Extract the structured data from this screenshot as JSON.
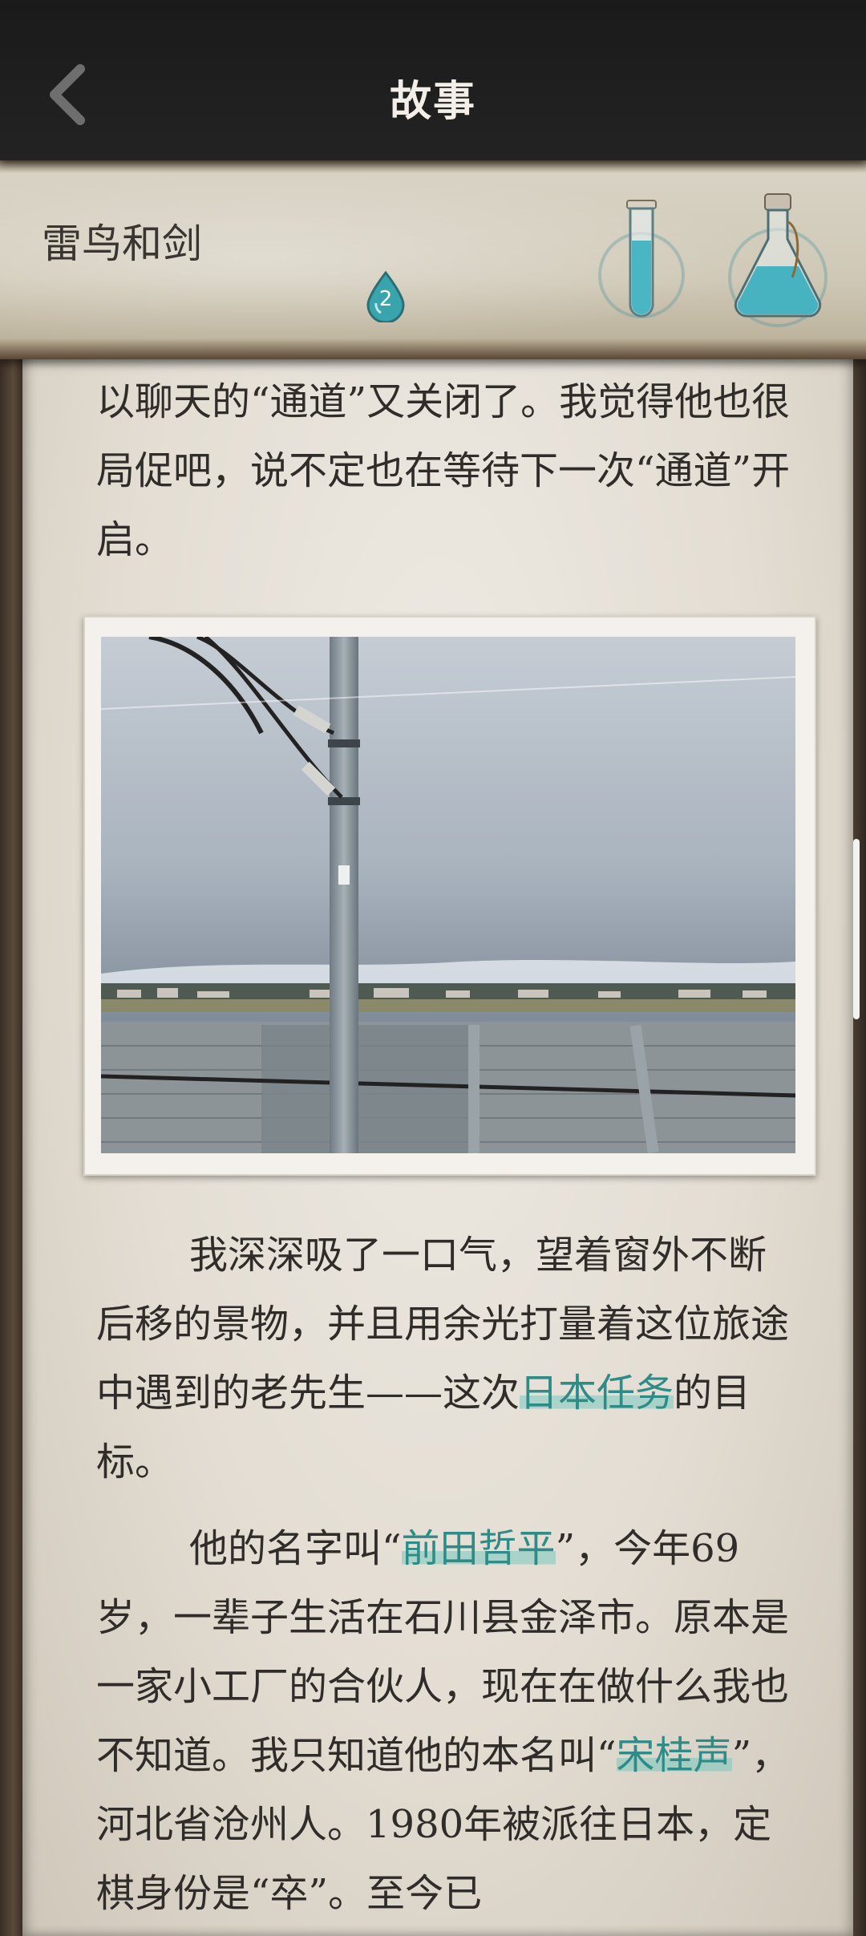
{
  "header": {
    "title": "故事"
  },
  "banner": {
    "book_title": "雷鸟和剑",
    "drop_count": "2"
  },
  "content": {
    "para1": "以聊天的“通道”又关闭了。我觉得他也很局促吧，说不定也在等待下一次“通道”开启。",
    "para2": {
      "before": "我深深吸了一口气，望着窗外不断后移的景物，并且用余光打量着这位旅途中遇到的老先生——这次",
      "highlight": "日本任务",
      "after": "的目标。"
    },
    "para3": {
      "p1": "他的名字叫“",
      "h1": "前田哲平",
      "p2": "”，今年69岁，一辈子生活在石川县金泽市。原本是一家小工厂的合伙人，现在在做什么我也不知道。我只知道他的本名叫“",
      "h2": "宋桂声",
      "p3": "”，河北省沧州人。1980年被派往日本，定棋身份是“卒”。至今已"
    }
  },
  "colors": {
    "highlight_text": "#2e8c88",
    "highlight_bg": "#9fd3cb",
    "page_bg": "#e6e1d8",
    "topbar_bg": "#1d1d1d"
  },
  "icons": [
    "back-chevron-icon",
    "water-drop-icon",
    "test-tube-icon",
    "potion-flask-icon"
  ]
}
